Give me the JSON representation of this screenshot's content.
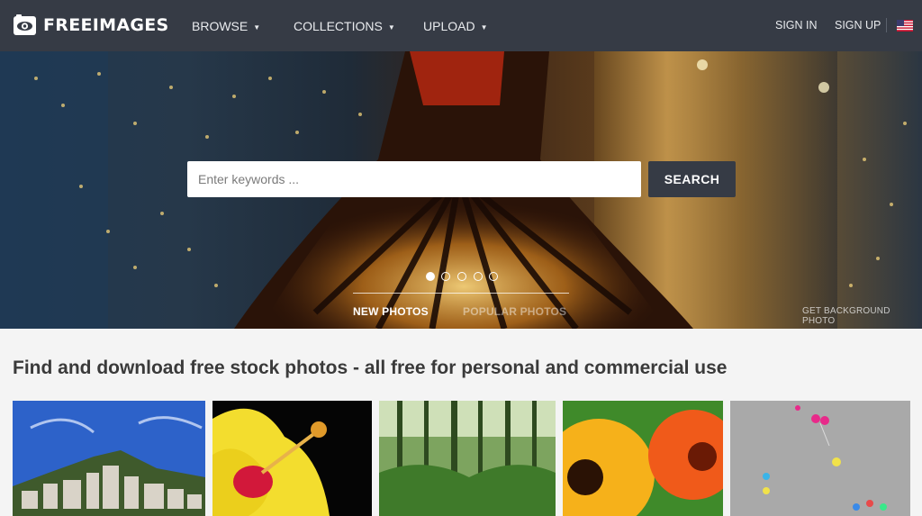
{
  "brand": {
    "name": "FREEIMAGES",
    "icon": "camera-eye-icon"
  },
  "nav": {
    "browse": "BROWSE",
    "collections": "COLLECTIONS",
    "upload": "UPLOAD",
    "caret": "▼"
  },
  "auth": {
    "sign_in": "SIGN IN",
    "sign_up": "SIGN UP",
    "language_flag": "us-flag-icon"
  },
  "hero": {
    "search_placeholder": "Enter keywords ...",
    "search_button": "SEARCH",
    "slides_total": 5,
    "slide_active": 1,
    "tabs": {
      "new": "NEW PHOTOS",
      "popular": "POPULAR PHOTOS"
    },
    "get_background": "GET BACKGROUND PHOTO"
  },
  "main": {
    "headline": "Find and download free stock photos - all free for personal and commercial use",
    "thumbnails": [
      "hillside-town-photo",
      "yellow-hibiscus-photo",
      "forest-photo",
      "gerbera-flowers-photo",
      "balloons-photo"
    ]
  },
  "colors": {
    "header_bg": "#363b45",
    "accent_dark": "#363b45",
    "page_bg": "#f4f4f4"
  }
}
